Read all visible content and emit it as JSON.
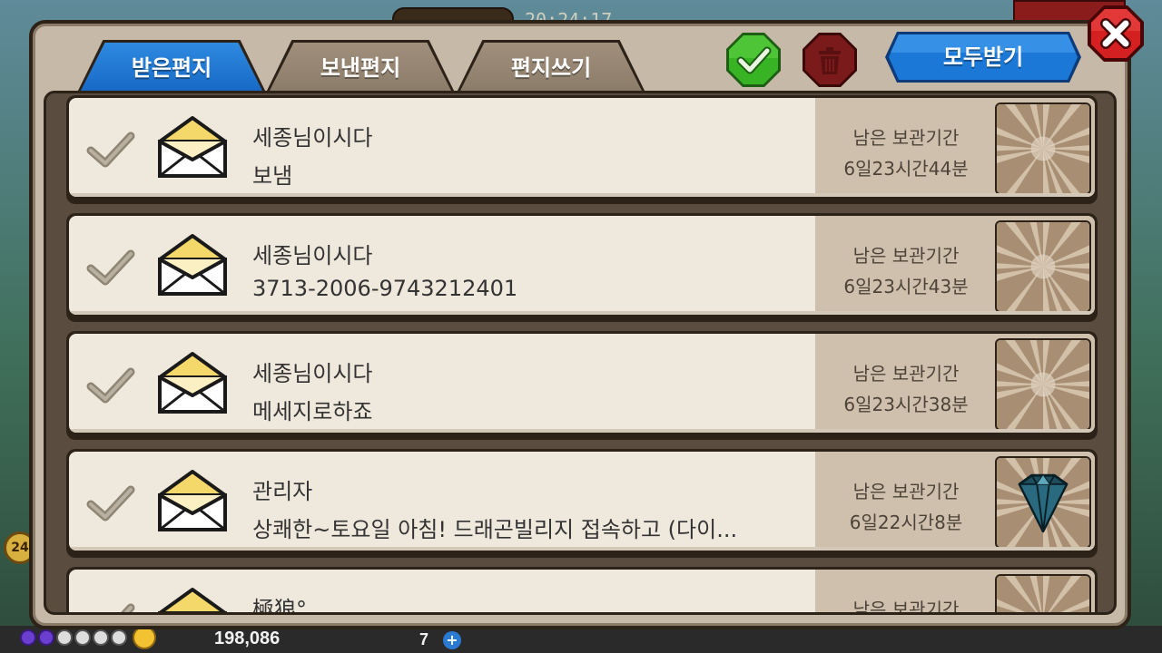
{
  "background": {
    "top_time": "20:24:17",
    "gold": "198,086",
    "gems": "7",
    "plus": "+",
    "level": "24"
  },
  "tabs": [
    {
      "label": "받은편지",
      "active": true
    },
    {
      "label": "보낸편지",
      "active": false
    },
    {
      "label": "편지쓰기",
      "active": false
    }
  ],
  "toolbar": {
    "receive_all_label": "모두받기",
    "confirm_icon": "check-icon",
    "delete_icon": "trash-icon",
    "close_icon": "close-icon"
  },
  "mail": [
    {
      "sender": "세종님이시다",
      "message": "보냄",
      "expiry_label": "남은 보관기간",
      "expiry_time": "6일23시간44분",
      "reward": "none"
    },
    {
      "sender": "세종님이시다",
      "message": "3713-2006-9743212401",
      "expiry_label": "남은 보관기간",
      "expiry_time": "6일23시간43분",
      "reward": "none"
    },
    {
      "sender": "세종님이시다",
      "message": "메세지로하죠",
      "expiry_label": "남은 보관기간",
      "expiry_time": "6일23시간38분",
      "reward": "none"
    },
    {
      "sender": "관리자",
      "message": "상쾌한~토요일 아침! 드래곤빌리지 접속하고 (다이...",
      "expiry_label": "남은 보관기간",
      "expiry_time": "6일22시간8분",
      "reward": "diamond"
    },
    {
      "sender": "極狼°",
      "message": "",
      "expiry_label": "남은 보관기간",
      "expiry_time": "",
      "reward": "none"
    }
  ],
  "colors": {
    "tab_active": "#1d74d0",
    "confirm_green": "#2fa81e",
    "delete_red": "#7a1a1a",
    "receive_blue": "#1b78d6",
    "close_red": "#d42020"
  }
}
